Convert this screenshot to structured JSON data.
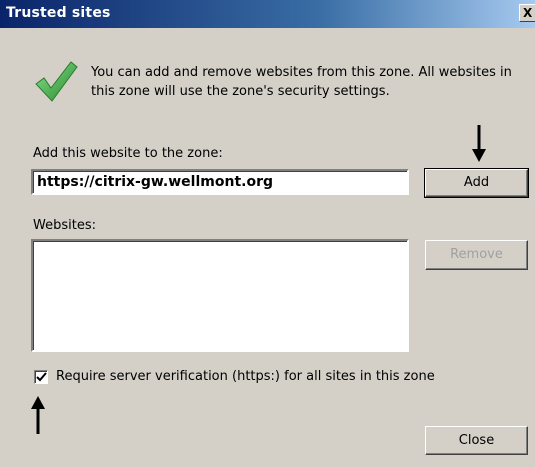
{
  "window": {
    "title": "Trusted sites",
    "close_glyph": "X"
  },
  "info": {
    "icon": "checkmark-icon",
    "text": "You can add and remove websites from this zone. All websites in this zone will use the zone's security settings."
  },
  "add_section": {
    "label": "Add this website to the zone:",
    "url_value": "https://citrix-gw.wellmont.org",
    "add_button": "Add"
  },
  "websites_section": {
    "label": "Websites:",
    "items": [],
    "remove_button": "Remove"
  },
  "options": {
    "require_https_label": "Require server verification (https:) for all sites in this zone",
    "require_https_checked": true
  },
  "footer": {
    "close_button": "Close"
  },
  "annotations": {
    "arrow_down_target": "add-button",
    "arrow_up_target": "require-https-checkbox"
  },
  "colors": {
    "titlebar_start": "#0a246a",
    "dialog_bg": "#d4d0c8",
    "check_green": "#3ca43c",
    "disabled_text": "#a0a0a0"
  }
}
